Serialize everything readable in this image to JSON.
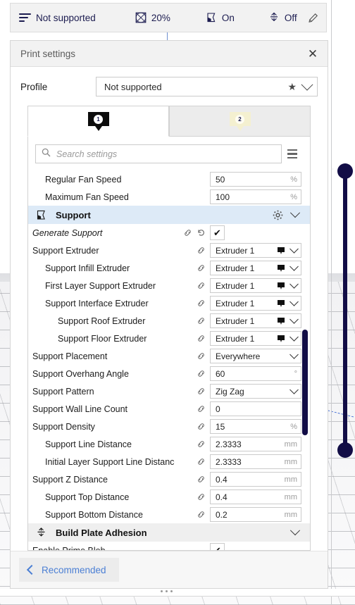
{
  "top_bar": {
    "items": [
      {
        "icon": "layer-height-icon",
        "label": "Not supported"
      },
      {
        "icon": "infill-icon",
        "label": "20%"
      },
      {
        "icon": "support-icon",
        "label": "On"
      },
      {
        "icon": "adhesion-icon",
        "label": "Off"
      }
    ],
    "edit_icon": "pencil-icon"
  },
  "dialog": {
    "title": "Print settings",
    "close_icon": "close-icon",
    "profile": {
      "label": "Profile",
      "value": "Not supported",
      "star_icon": "star-icon",
      "chevron_icon": "chevron-down-icon"
    },
    "tabs": [
      {
        "badge": "1",
        "style": "dark",
        "state": "active"
      },
      {
        "badge": "2",
        "style": "pale",
        "state": "inactive"
      }
    ],
    "search": {
      "placeholder": "Search settings",
      "value": "",
      "search_icon": "search-icon",
      "menu_icon": "hamburger-menu-icon"
    },
    "footer": {
      "recommended_label": "Recommended",
      "back_icon": "chevron-left-icon"
    }
  },
  "settings_rows": [
    {
      "kind": "setting",
      "label": "Regular Fan Speed",
      "indent": 1,
      "modified": false,
      "link": false,
      "revert": false,
      "control": "text",
      "value": "50",
      "unit": "%"
    },
    {
      "kind": "setting",
      "label": "Maximum Fan Speed",
      "indent": 1,
      "modified": false,
      "link": false,
      "revert": false,
      "control": "text",
      "value": "100",
      "unit": "%"
    },
    {
      "kind": "category",
      "label": "Support",
      "icon": "support-icon",
      "highlighted": true,
      "gear": true,
      "chevron": true
    },
    {
      "kind": "setting",
      "label": "Generate Support",
      "indent": 0,
      "modified": true,
      "link": true,
      "revert": true,
      "control": "checkbox",
      "value": "checked",
      "unit": ""
    },
    {
      "kind": "setting",
      "label": "Support Extruder",
      "indent": 0,
      "modified": false,
      "link": true,
      "revert": false,
      "control": "dropdown-swatch",
      "value": "Extruder 1",
      "unit": ""
    },
    {
      "kind": "setting",
      "label": "Support Infill Extruder",
      "indent": 1,
      "modified": false,
      "link": true,
      "revert": false,
      "control": "dropdown-swatch",
      "value": "Extruder 1",
      "unit": ""
    },
    {
      "kind": "setting",
      "label": "First Layer Support Extruder",
      "indent": 1,
      "modified": false,
      "link": true,
      "revert": false,
      "control": "dropdown-swatch",
      "value": "Extruder 1",
      "unit": ""
    },
    {
      "kind": "setting",
      "label": "Support Interface Extruder",
      "indent": 1,
      "modified": false,
      "link": true,
      "revert": false,
      "control": "dropdown-swatch",
      "value": "Extruder 1",
      "unit": ""
    },
    {
      "kind": "setting",
      "label": "Support Roof Extruder",
      "indent": 2,
      "modified": false,
      "link": true,
      "revert": false,
      "control": "dropdown-swatch",
      "value": "Extruder 1",
      "unit": ""
    },
    {
      "kind": "setting",
      "label": "Support Floor Extruder",
      "indent": 2,
      "modified": false,
      "link": true,
      "revert": false,
      "control": "dropdown-swatch",
      "value": "Extruder 1",
      "unit": ""
    },
    {
      "kind": "setting",
      "label": "Support Placement",
      "indent": 0,
      "modified": false,
      "link": true,
      "revert": false,
      "control": "dropdown",
      "value": "Everywhere",
      "unit": ""
    },
    {
      "kind": "setting",
      "label": "Support Overhang Angle",
      "indent": 0,
      "modified": false,
      "link": true,
      "revert": false,
      "control": "text",
      "value": "60",
      "unit": "°"
    },
    {
      "kind": "setting",
      "label": "Support Pattern",
      "indent": 0,
      "modified": false,
      "link": true,
      "revert": false,
      "control": "dropdown",
      "value": "Zig Zag",
      "unit": ""
    },
    {
      "kind": "setting",
      "label": "Support Wall Line Count",
      "indent": 0,
      "modified": false,
      "link": true,
      "revert": false,
      "control": "text",
      "value": "0",
      "unit": ""
    },
    {
      "kind": "setting",
      "label": "Support Density",
      "indent": 0,
      "modified": false,
      "link": true,
      "revert": false,
      "control": "text",
      "value": "15",
      "unit": "%"
    },
    {
      "kind": "setting",
      "label": "Support Line Distance",
      "indent": 1,
      "modified": false,
      "link": true,
      "revert": false,
      "control": "text",
      "value": "2.3333",
      "unit": "mm"
    },
    {
      "kind": "setting",
      "label": "Initial Layer Support Line Distance",
      "indent": 1,
      "modified": false,
      "link": true,
      "revert": false,
      "control": "text",
      "value": "2.3333",
      "unit": "mm"
    },
    {
      "kind": "setting",
      "label": "Support Z Distance",
      "indent": 0,
      "modified": false,
      "link": true,
      "revert": false,
      "control": "text",
      "value": "0.4",
      "unit": "mm"
    },
    {
      "kind": "setting",
      "label": "Support Top Distance",
      "indent": 1,
      "modified": false,
      "link": true,
      "revert": false,
      "control": "text",
      "value": "0.4",
      "unit": "mm"
    },
    {
      "kind": "setting",
      "label": "Support Bottom Distance",
      "indent": 1,
      "modified": false,
      "link": true,
      "revert": false,
      "control": "text",
      "value": "0.2",
      "unit": "mm"
    },
    {
      "kind": "category",
      "label": "Build Plate Adhesion",
      "icon": "adhesion-icon",
      "highlighted": false,
      "gear": false,
      "chevron": true
    },
    {
      "kind": "setting",
      "label": "Enable Prime Blob",
      "indent": 0,
      "modified": false,
      "link": false,
      "revert": false,
      "control": "checkbox",
      "value": "checked",
      "unit": ""
    }
  ],
  "layer_slider": {
    "name": "layer-view-slider",
    "color": "#120d46"
  },
  "colors": {
    "accent_navy": "#120d46",
    "link_blue": "#4b7fd4",
    "category_highlight": "#ddeaf7",
    "badge_pale": "#f4f0d0"
  }
}
